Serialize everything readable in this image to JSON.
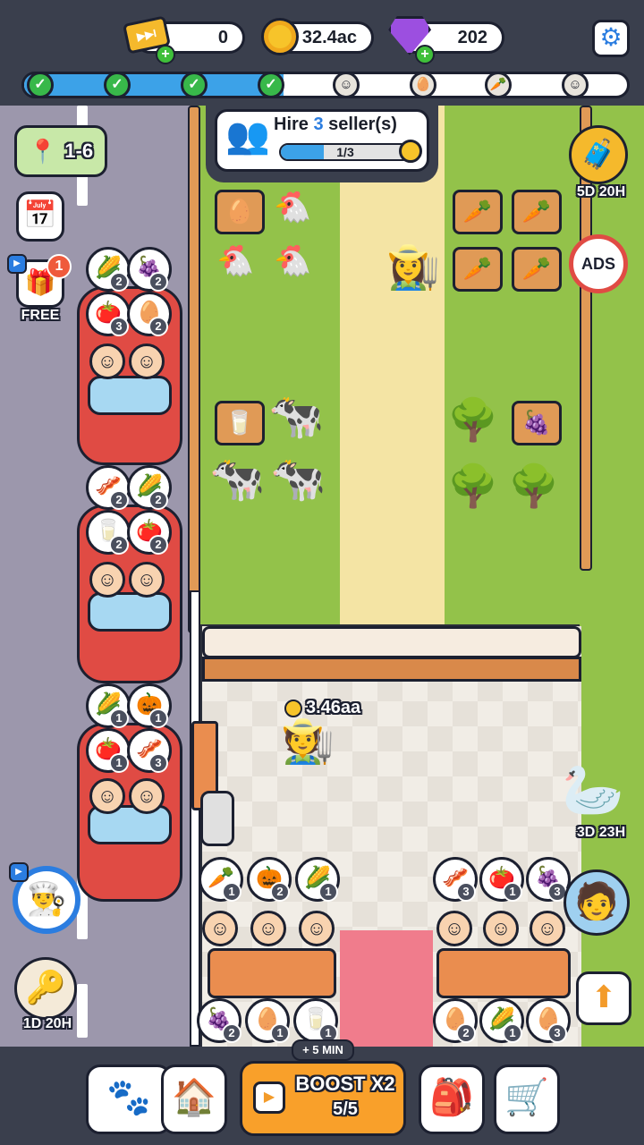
{
  "currency": {
    "tickets": "0",
    "coins": "32.4ac",
    "gems": "202"
  },
  "progress": {
    "fill_fraction": 0.43,
    "completed_checks": 4,
    "upcoming_icons": [
      "worker-face-icon",
      "eggs-icon",
      "carrot-icon",
      "worker-face-icon"
    ]
  },
  "location": {
    "label": "1-6"
  },
  "hire": {
    "prefix": "Hire ",
    "number": "3",
    "suffix": " seller(s)",
    "progress_label": "1/3",
    "progress_fraction": 0.333
  },
  "side_left": {
    "free_badge": "1",
    "free_label": "FREE",
    "key_timer": "1D 20H"
  },
  "side_right": {
    "hanger_timer": "5D 20H",
    "ads_label": "ADS",
    "goose_timer": "3D 23H"
  },
  "seller": {
    "earnings": "3.46aa"
  },
  "cars": [
    {
      "orders": [
        {
          "item": "corn",
          "glyph": "🌽",
          "count": "2"
        },
        {
          "item": "raspberry",
          "glyph": "🍇",
          "count": "2"
        },
        {
          "item": "tomato",
          "glyph": "🍅",
          "count": "3"
        },
        {
          "item": "eggs",
          "glyph": "🥚",
          "count": "2"
        }
      ]
    },
    {
      "orders": [
        {
          "item": "bacon",
          "glyph": "🥓",
          "count": "2"
        },
        {
          "item": "corn",
          "glyph": "🌽",
          "count": "2"
        },
        {
          "item": "milk",
          "glyph": "🥛",
          "count": "2"
        },
        {
          "item": "tomato",
          "glyph": "🍅",
          "count": "2"
        }
      ]
    },
    {
      "orders": [
        {
          "item": "corn",
          "glyph": "🌽",
          "count": "1"
        },
        {
          "item": "pumpkin",
          "glyph": "🎃",
          "count": "1"
        },
        {
          "item": "tomato",
          "glyph": "🍅",
          "count": "1"
        },
        {
          "item": "bacon",
          "glyph": "🥓",
          "count": "3"
        }
      ]
    }
  ],
  "counter_left": {
    "orders": [
      {
        "item": "carrot",
        "glyph": "🥕",
        "count": "1"
      },
      {
        "item": "pumpkin",
        "glyph": "🎃",
        "count": "2"
      },
      {
        "item": "corn",
        "glyph": "🌽",
        "count": "1"
      }
    ],
    "stock": [
      {
        "item": "raspberry",
        "glyph": "🍇",
        "count": "2"
      },
      {
        "item": "eggs",
        "glyph": "🥚",
        "count": "1"
      },
      {
        "item": "milk",
        "glyph": "🥛",
        "count": "1"
      }
    ]
  },
  "counter_right": {
    "orders": [
      {
        "item": "bacon",
        "glyph": "🥓",
        "count": "3"
      },
      {
        "item": "tomato",
        "glyph": "🍅",
        "count": "1"
      },
      {
        "item": "raspberry",
        "glyph": "🍇",
        "count": "3"
      }
    ],
    "stock": [
      {
        "item": "eggs",
        "glyph": "🥚",
        "count": "2"
      },
      {
        "item": "corn",
        "glyph": "🌽",
        "count": "1"
      },
      {
        "item": "eggs",
        "glyph": "🥚",
        "count": "3"
      }
    ]
  },
  "boost": {
    "bonus": "+ 5 MIN",
    "label": "BOOST X2",
    "uses": "5/5"
  },
  "bottom_nav": [
    "pets-icon",
    "farmhouse-icon",
    "backpack-icon",
    "shop-cart-icon"
  ],
  "colors": {
    "progress_blue": "#3ca2e8",
    "check_green": "#38b84a",
    "boost_orange": "#f9a02a",
    "car_red": "#e04b44",
    "grass": "#93c24a"
  }
}
